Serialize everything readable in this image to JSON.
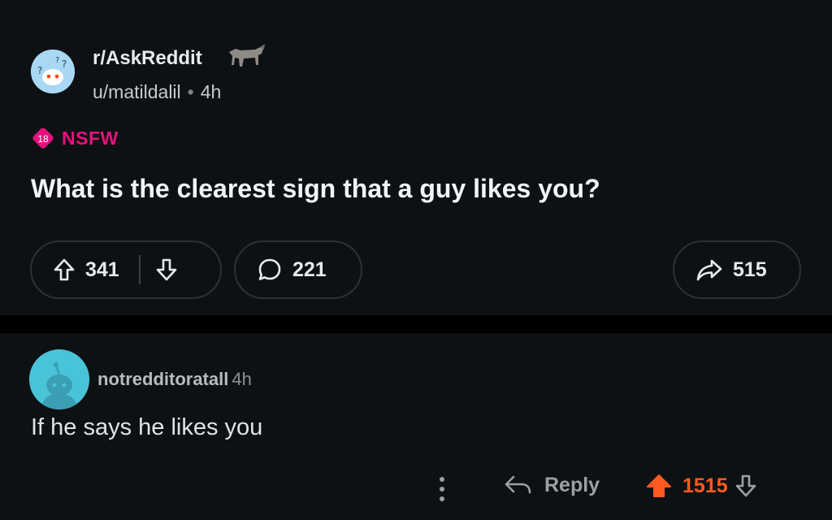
{
  "post": {
    "subreddit": "r/AskReddit",
    "author": "u/matildalil",
    "separator": "•",
    "age": "4h",
    "nsfw_badge": "18",
    "nsfw_label": "NSFW",
    "title": "What is the clearest sign that a guy likes you?",
    "upvotes": "341",
    "comments": "221",
    "shares": "515"
  },
  "comment": {
    "author": "notredditoratall",
    "age": "4h",
    "body": "If he says he likes you",
    "reply_label": "Reply",
    "score": "1515"
  },
  "colors": {
    "background": "#0e1113",
    "nsfw": "#e5127e",
    "upvote_active": "#ff5a1f"
  },
  "icons": [
    "subreddit-avatar-icon",
    "horse-flair-icon",
    "nsfw-18-icon",
    "upvote-icon",
    "downvote-icon",
    "comment-bubble-icon",
    "share-icon",
    "more-options-icon",
    "reply-icon"
  ]
}
